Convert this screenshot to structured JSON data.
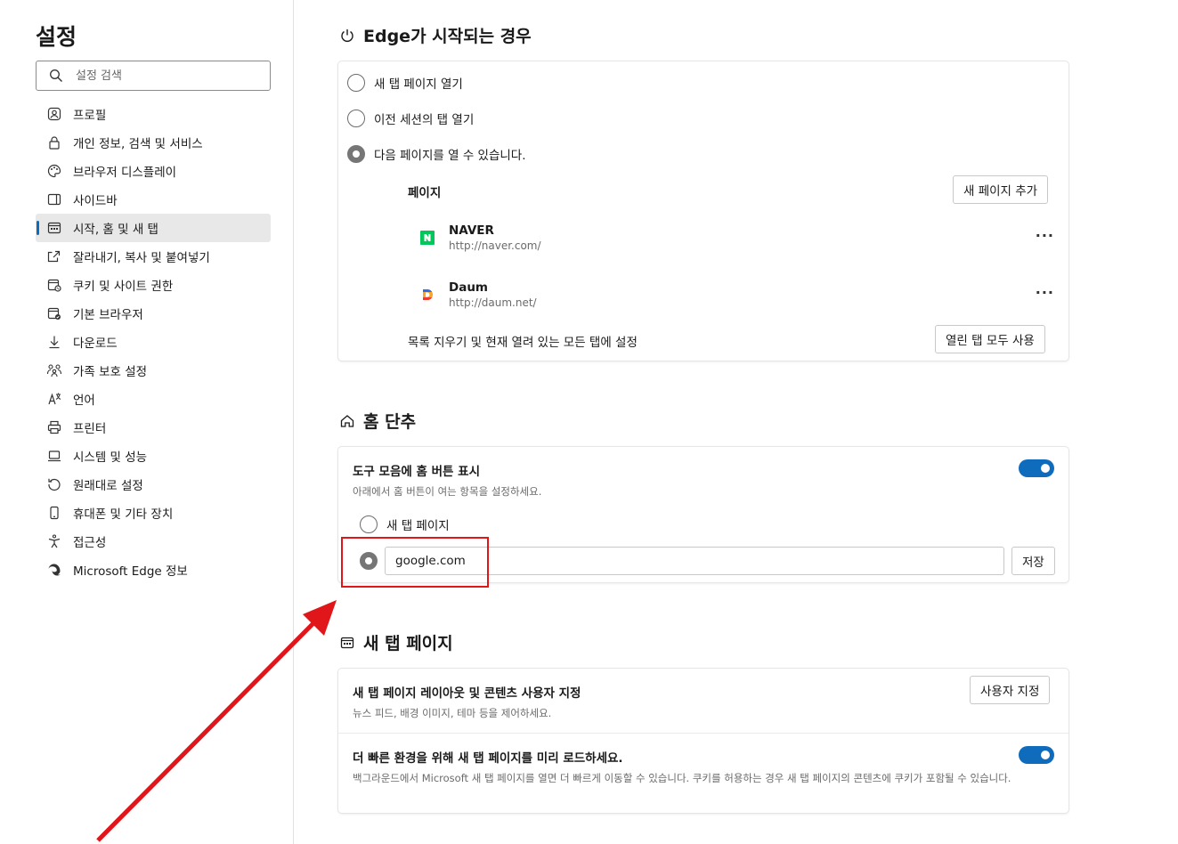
{
  "sidebar": {
    "title": "설정",
    "search_placeholder": "설정 검색",
    "items": [
      {
        "label": "프로필",
        "icon": "profile-icon"
      },
      {
        "label": "개인 정보, 검색 및 서비스",
        "icon": "lock-icon"
      },
      {
        "label": "브라우저 디스플레이",
        "icon": "palette-icon"
      },
      {
        "label": "사이드바",
        "icon": "sidebar-icon"
      },
      {
        "label": "시작, 홈 및 새 탭",
        "icon": "start-home-icon",
        "active": true
      },
      {
        "label": "잘라내기, 복사 및 붙여넣기",
        "icon": "share-icon"
      },
      {
        "label": "쿠키 및 사이트 권한",
        "icon": "cookie-icon"
      },
      {
        "label": "기본 브라우저",
        "icon": "default-browser-icon"
      },
      {
        "label": "다운로드",
        "icon": "download-icon"
      },
      {
        "label": "가족 보호 설정",
        "icon": "family-icon"
      },
      {
        "label": "언어",
        "icon": "language-icon"
      },
      {
        "label": "프린터",
        "icon": "printer-icon"
      },
      {
        "label": "시스템 및 성능",
        "icon": "laptop-icon"
      },
      {
        "label": "원래대로 설정",
        "icon": "reset-icon"
      },
      {
        "label": "휴대폰 및 기타 장치",
        "icon": "phone-icon"
      },
      {
        "label": "접근성",
        "icon": "accessibility-icon"
      },
      {
        "label": "Microsoft Edge 정보",
        "icon": "edge-icon"
      }
    ]
  },
  "startup": {
    "title": "Edge가 시작되는 경우",
    "options": [
      "새 탭 페이지 열기",
      "이전 세션의 탭 열기",
      "다음 페이지를 열 수 있습니다."
    ],
    "selected_index": 2,
    "pages_label": "페이지",
    "add_page_button": "새 페이지 추가",
    "pages": [
      {
        "name": "NAVER",
        "url": "http://naver.com/",
        "icon": "naver-icon"
      },
      {
        "name": "Daum",
        "url": "http://daum.net/",
        "icon": "daum-icon"
      }
    ],
    "more_glyph": "···",
    "clear_label": "목록 지우기 및 현재 열려 있는 모든 탭에 설정",
    "use_all_tabs_button": "열린 탭 모두 사용"
  },
  "home": {
    "title": "홈 단추",
    "show_home_label": "도구 모음에 홈 버튼 표시",
    "show_home_sub": "아래에서 홈 버튼이 여는 항목을 설정하세요.",
    "show_home_enabled": true,
    "option_new_tab": "새 탭 페이지",
    "url_value": "google.com",
    "save_button": "저장"
  },
  "newtab": {
    "title": "새 탭 페이지",
    "customize_label": "새 탭 페이지 레이아웃 및 콘텐츠 사용자 지정",
    "customize_sub": "뉴스 피드, 배경 이미지, 테마 등을 제어하세요.",
    "customize_button": "사용자 지정",
    "preload_label": "더 빠른 환경을 위해 새 탭 페이지를 미리 로드하세요.",
    "preload_sub": "백그라운드에서 Microsoft 새 탭 페이지를 열면 더 빠르게 이동할 수 있습니다. 쿠키를 허용하는 경우 새 탭 페이지의 콘텐츠에 쿠키가 포함될 수 있습니다.",
    "preload_enabled": true
  },
  "colors": {
    "accent": "#0f6cbd",
    "annotation": "#e0161b"
  }
}
